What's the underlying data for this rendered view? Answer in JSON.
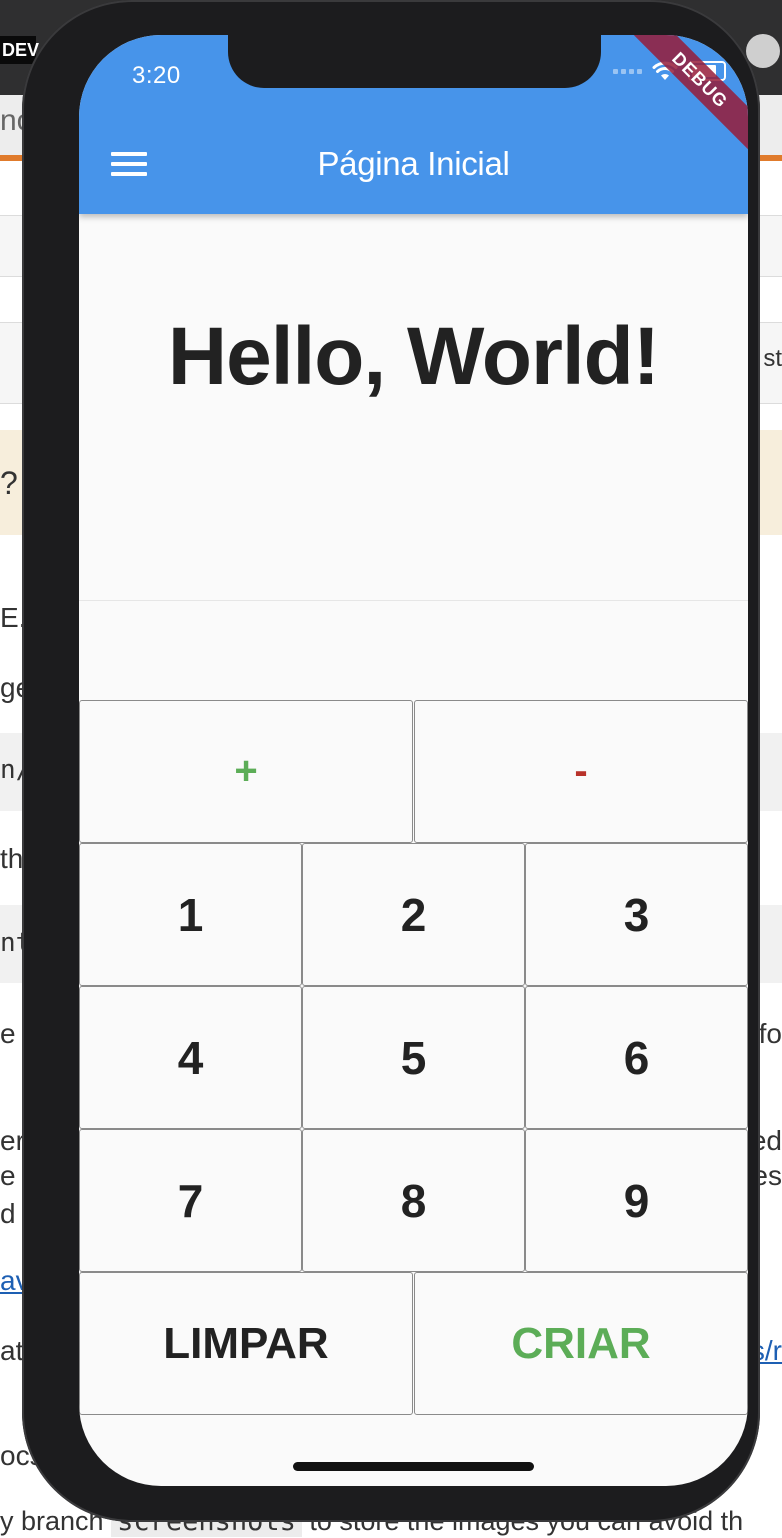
{
  "background": {
    "dev_logo": "DEV",
    "url_fragment": "nc",
    "snippets": [
      "st",
      "?",
      "E.r",
      "ge",
      "n/",
      "th",
      "nt",
      "e",
      "e fo",
      "er",
      "ed",
      "e w",
      "es",
      "d",
      "av",
      "ativ",
      "s/r",
      "ocs"
    ],
    "bottom_line": {
      "before": "y branch ",
      "code": "screenshots",
      "after": " to store the images you can avoid th"
    }
  },
  "status_bar": {
    "time": "3:20"
  },
  "app_bar": {
    "title": "Página Inicial",
    "menu_icon": "hamburger-menu-icon",
    "color": "#4794ea"
  },
  "debug_banner": "DEBUG",
  "main": {
    "greeting": "Hello, World!"
  },
  "keypad": {
    "plus": "+",
    "minus": "-",
    "digits": [
      "1",
      "2",
      "3",
      "4",
      "5",
      "6",
      "7",
      "8",
      "9"
    ],
    "clear": "LIMPAR",
    "create": "CRIAR",
    "colors": {
      "plus": "#5cad57",
      "minus": "#b8322a",
      "create": "#5cad57"
    }
  }
}
